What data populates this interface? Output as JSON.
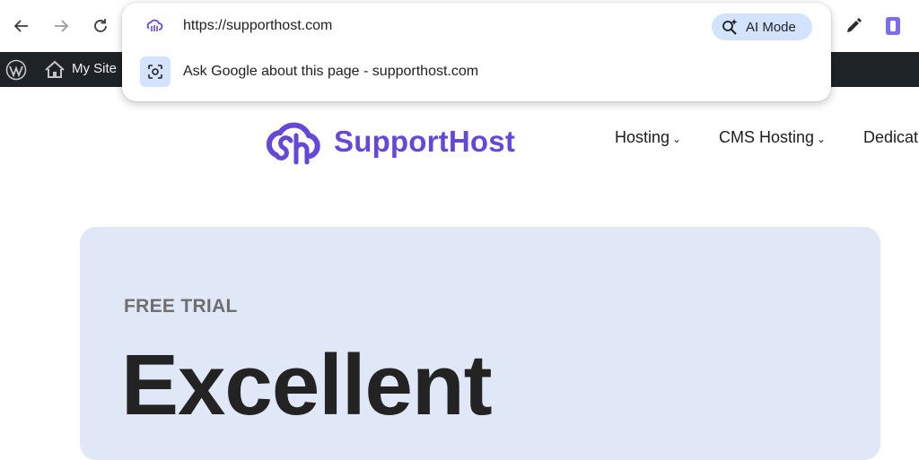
{
  "browser": {
    "omnibox": {
      "url": "https://supporthost.com",
      "ai_mode_label": "AI Mode",
      "suggestion": "Ask Google about this page - supporthost.com"
    },
    "icons": [
      "back-arrow-icon",
      "forward-arrow-icon",
      "reload-icon",
      "site-favicon",
      "ai-mode-search-icon",
      "lens-page-icon",
      "pencil-icon",
      "extension-icon"
    ]
  },
  "admin_bar": {
    "site_label": "My Site"
  },
  "site": {
    "brand": "SupportHost",
    "brand_color": "#6548d8",
    "nav": [
      {
        "label": "Hosting"
      },
      {
        "label": "CMS Hosting"
      },
      {
        "label": "Dedicat"
      }
    ],
    "hero": {
      "eyebrow": "FREE TRIAL",
      "title": "Excellent"
    }
  }
}
